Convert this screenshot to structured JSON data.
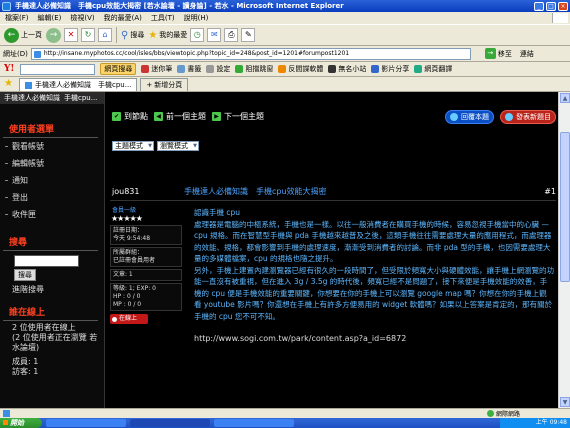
{
  "window": {
    "title": "手機達人必備知識　手機cpu效能大揭密 [若水論壇 - 讀身論] - 若水 - Microsoft Internet Explorer"
  },
  "menu": [
    "檔案(F)",
    "編輯(E)",
    "檢視(V)",
    "我的最愛(A)",
    "工具(T)",
    "說明(H)"
  ],
  "toolbar": {
    "back_label": "上一頁",
    "search_label": "搜尋",
    "favorites_label": "我的最愛"
  },
  "address": {
    "label": "網址(D)",
    "url": "http://insane.myphotos.cc/cool/isles/bbs/viewtopic.php?topic_id=248&post_id=1201#forumpost1201",
    "go_label": "移至",
    "links_label": "連結"
  },
  "ytoolbar": {
    "logo": "Y!",
    "items": [
      "網頁搜尋",
      "迷你筆",
      "書籤",
      "設定",
      "阻擋跳窗",
      "反間諜軟體",
      "無名小站",
      "影片分享",
      "網頁翻譯"
    ]
  },
  "tabs": [
    "手機達人必備知識　手機cpu...",
    "新增分頁"
  ],
  "sidebar": {
    "top_items": [
      "手機達人必備知識",
      "手機cpu..."
    ],
    "user_menu_title": "使用者選單",
    "user_menu_items": [
      "觀看帳號",
      "編輯帳號",
      "通知",
      "登出",
      "收件匣"
    ],
    "search_title": "搜尋",
    "search_button": "搜尋",
    "advanced_search": "進階搜尋",
    "online_title": "誰在線上",
    "online_text": "2 位使用者在線上\n(2 位使用者正在瀏覽 若水論壇)",
    "members": "成員: 1",
    "guests": "訪客: 1"
  },
  "nav": {
    "top_label": "到節點",
    "prev_label": "前一個主題",
    "next_label": "下一個主題",
    "reply_label": "回覆本題",
    "new_topic_label": "發表新題目",
    "select_mode": "主題模式",
    "select_order": "瀏覽模式"
  },
  "post": {
    "author": "jou831",
    "title": "手機達人必備知識　手機cpu效能大揭密",
    "number": "#1",
    "rank": "會員一級",
    "stars": "★★★★★",
    "registered_label": "註冊日期：",
    "registered_value": "今天 9:54:48",
    "group_label": "所屬群組：",
    "group_value": "已註冊會員用者",
    "posts": "文章: 1",
    "level": "等級: 1; EXP: 0",
    "hp": "HP : 0 / 0",
    "mp": "MP : 0 / 0",
    "online_badge": "在線上",
    "content_title": "認識手機 cpu",
    "paragraph1": "處理器是電腦的中樞系統，手機也是一樣。以往一般消費者在購買手機的時候，容易忽視手機當中的心臟 — cpu 規格。而在智慧型手機與 pda 手機越來越普及之後，這類手機往往需要處理大量的應用程式，而處理器的效能、規格，都會影響到手機的處理速度，漸漸受到消費者的討論。而非 pda 型的手機，也因需要處理大量的多媒體檔案，cpu 的規格也隨之提升。",
    "paragraph2": "另外，手機上建置內建瀏覽器已經有很久的一段時間了，但受限於頻寬大小與硬體效能，讓手機上網瀏覽的功能一直沒有被重視，但在進入 3g / 3.5g 的時代後，頻寬已經不是問題了，接下來便是手機效能的效善，手機的 cpu 便是手機效能的重要關鍵，你想要在你的手機上可以瀏覽 google map 嗎？你想在你的手機上觀看 youtube 影片嗎？你還想在手機上有許多方便易用的 widget 軟體嗎？如果以上答案是肯定的，那有關於手機的 cpu 您不可不知。",
    "link": "http://www.sogi.com.tw/park/content.asp?a_id=6872"
  },
  "statusbar": {
    "zone": "網際網路"
  },
  "taskbar": {
    "start_label": "開始",
    "clock": "上午 09:48"
  },
  "colors": {
    "accent_blue": "#4aa3ff",
    "sidebar_title_red": "#ff4020",
    "post_text": "#5cb7ff"
  }
}
